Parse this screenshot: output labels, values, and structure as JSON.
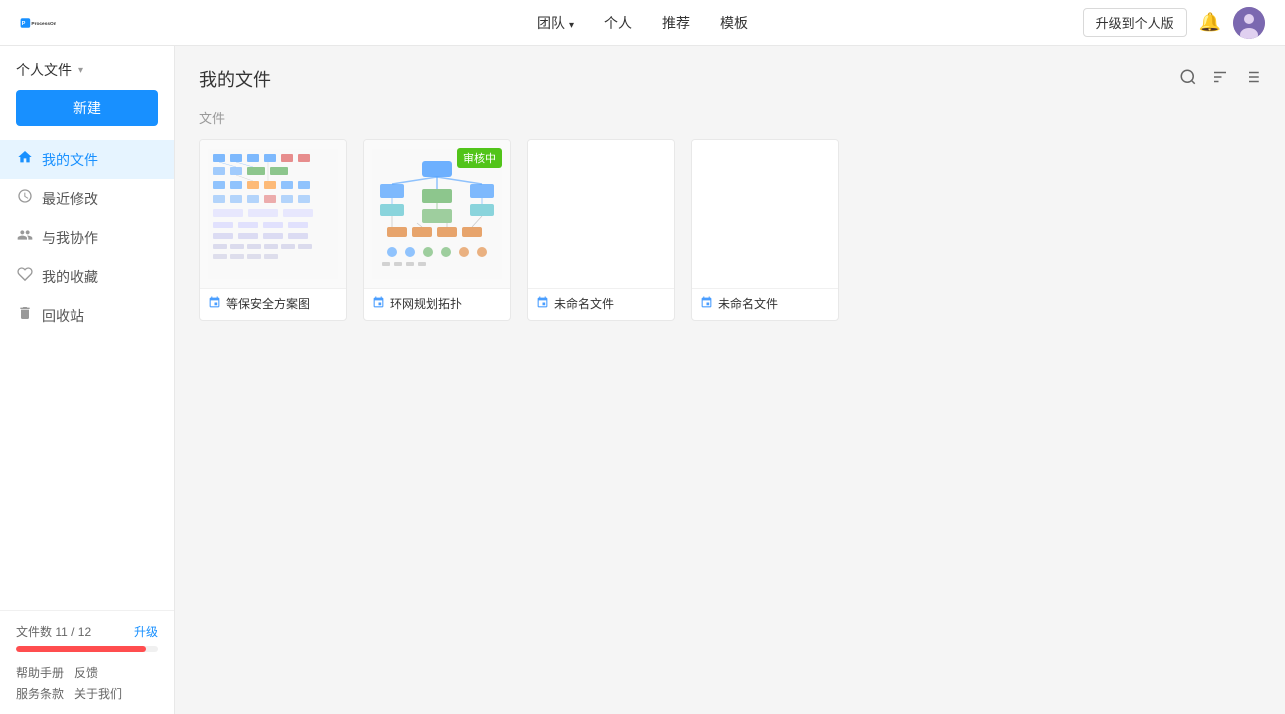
{
  "header": {
    "logo_text": "ProcessOn",
    "nav": [
      {
        "label": "团队",
        "has_dropdown": true
      },
      {
        "label": "个人",
        "has_dropdown": false
      },
      {
        "label": "推荐",
        "has_dropdown": false
      },
      {
        "label": "模板",
        "has_dropdown": false
      }
    ],
    "upgrade_btn": "升级到个人版",
    "bell_icon": "bell-icon",
    "avatar_icon": "avatar-icon"
  },
  "sidebar": {
    "personal_files_label": "个人文件",
    "new_btn": "新建",
    "items": [
      {
        "id": "my-files",
        "label": "我的文件",
        "icon": "🏠",
        "active": true
      },
      {
        "id": "recent",
        "label": "最近修改",
        "icon": "🕐",
        "active": false
      },
      {
        "id": "shared",
        "label": "与我协作",
        "icon": "👥",
        "active": false
      },
      {
        "id": "favorites",
        "label": "我的收藏",
        "icon": "♡",
        "active": false
      },
      {
        "id": "trash",
        "label": "回收站",
        "icon": "🗑",
        "active": false
      }
    ],
    "file_count_label": "文件数 11 / 12",
    "upgrade_link": "升级",
    "progress_percent": 91.67,
    "footer_links": [
      {
        "label": "帮助手册"
      },
      {
        "label": "反馈"
      }
    ],
    "footer_links2": [
      {
        "label": "服务条款"
      },
      {
        "label": "关于我们"
      }
    ]
  },
  "content": {
    "title": "我的文件",
    "section_label": "文件",
    "search_icon": "search-icon",
    "sort_icon": "sort-icon",
    "list_icon": "list-icon",
    "files": [
      {
        "id": "file-1",
        "name": "等保安全方案图",
        "type_icon": "diagram-icon",
        "has_thumbnail": true,
        "thumb_type": "security-diagram",
        "badge": null
      },
      {
        "id": "file-2",
        "name": "环网规划拓扑",
        "type_icon": "diagram-icon",
        "has_thumbnail": true,
        "thumb_type": "network-diagram",
        "badge": "审核中"
      },
      {
        "id": "file-3",
        "name": "未命名文件",
        "type_icon": "diagram-icon",
        "has_thumbnail": false,
        "thumb_type": null,
        "badge": null
      },
      {
        "id": "file-4",
        "name": "未命名文件",
        "type_icon": "diagram-icon",
        "has_thumbnail": false,
        "thumb_type": null,
        "badge": null
      }
    ]
  }
}
